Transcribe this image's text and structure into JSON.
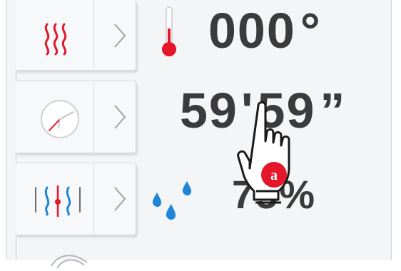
{
  "temperature": {
    "value": "000",
    "unit": "°"
  },
  "time": {
    "minutes": "59",
    "minute_mark": "'",
    "seconds": "59",
    "second_mark": "”"
  },
  "humidity": {
    "value": "75",
    "unit": "%"
  },
  "annotation": {
    "label": "a"
  },
  "icons": {
    "heat": "heat-waves-icon",
    "clock": "clock-icon",
    "humidity_control": "humidity-control-icon",
    "thermometer": "thermometer-icon",
    "drops": "water-drops-icon",
    "pointer": "hand-pointer-icon"
  },
  "colors": {
    "accent_red": "#e3162b",
    "drop_blue": "#1e86d8",
    "text": "#3b3b3b"
  }
}
